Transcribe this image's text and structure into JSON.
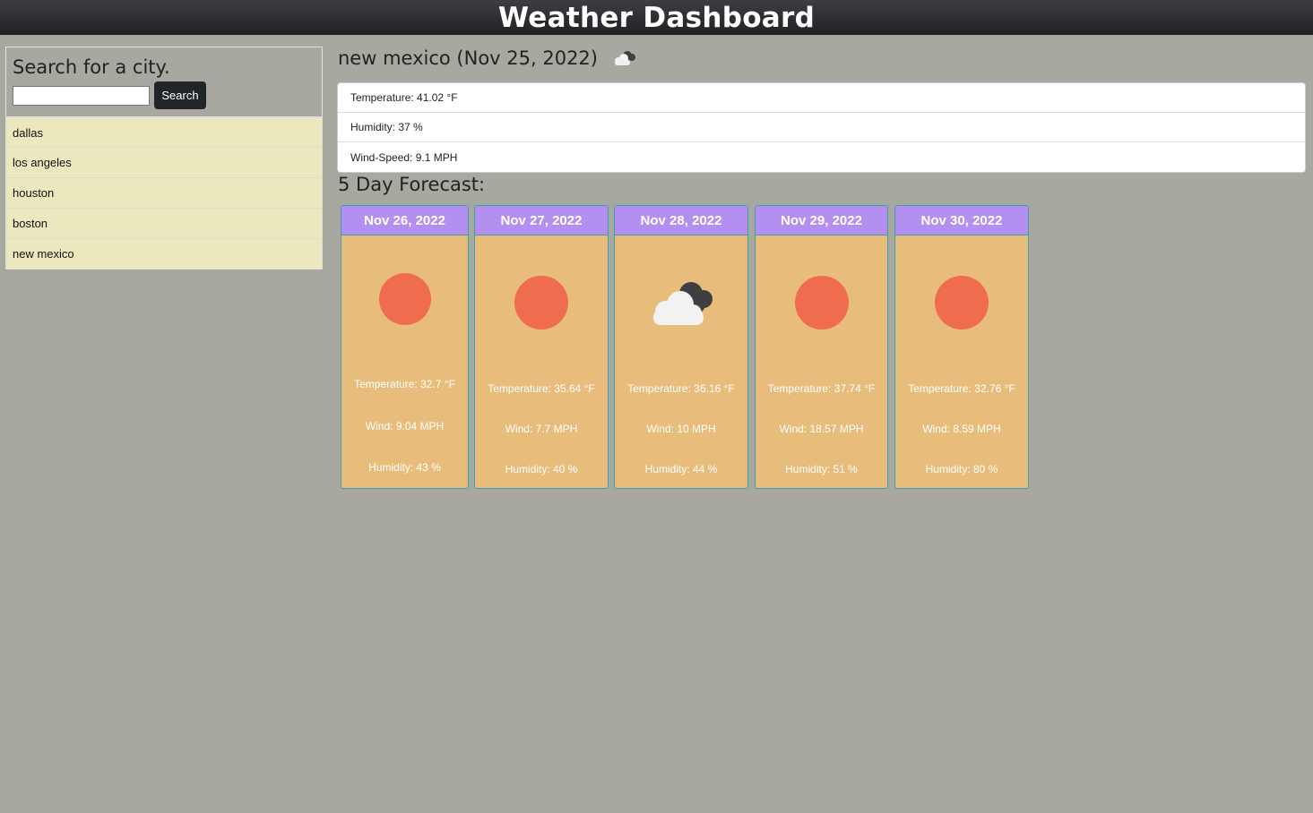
{
  "app": {
    "title": "Weather Dashboard"
  },
  "search": {
    "heading": "Search for a city.",
    "input_value": "",
    "placeholder": "",
    "button_label": "Search"
  },
  "history": [
    "dallas",
    "los angeles",
    "houston",
    "boston",
    "new mexico"
  ],
  "current": {
    "heading": "new mexico (Nov 25, 2022)",
    "icon": "cloudy-icon",
    "temperature": "Temperature: 41.02 °F",
    "humidity": "Humidity: 37 %",
    "wind": "Wind-Speed: 9.1 MPH"
  },
  "forecast": {
    "heading": "5 Day Forecast:",
    "days": [
      {
        "date": "Nov 26, 2022",
        "icon": "sun-icon",
        "temperature": "Temperature: 32.7 °F",
        "wind": "Wind: 9.04 MPH",
        "humidity": "Humidity: 43 %"
      },
      {
        "date": "Nov 27, 2022",
        "icon": "sun-icon",
        "temperature": "Temperature: 35.64 °F",
        "wind": "Wind: 7.7 MPH",
        "humidity": "Humidity: 40 %"
      },
      {
        "date": "Nov 28, 2022",
        "icon": "cloudy-icon",
        "temperature": "Temperature: 36.16 °F",
        "wind": "Wind: 10 MPH",
        "humidity": "Humidity: 44 %"
      },
      {
        "date": "Nov 29, 2022",
        "icon": "sun-icon",
        "temperature": "Temperature: 37.74 °F",
        "wind": "Wind: 18.57 MPH",
        "humidity": "Humidity: 51 %"
      },
      {
        "date": "Nov 30, 2022",
        "icon": "sun-icon",
        "temperature": "Temperature: 32.76 °F",
        "wind": "Wind: 8.59 MPH",
        "humidity": "Humidity: 80 %"
      }
    ]
  },
  "colors": {
    "page_background": "#a8a8a0",
    "header_background": "#212529",
    "history_item": "#ebe8be",
    "card_background": "#e8bd7c",
    "card_header": "#b38ff0",
    "sun": "#ef6c4f"
  }
}
